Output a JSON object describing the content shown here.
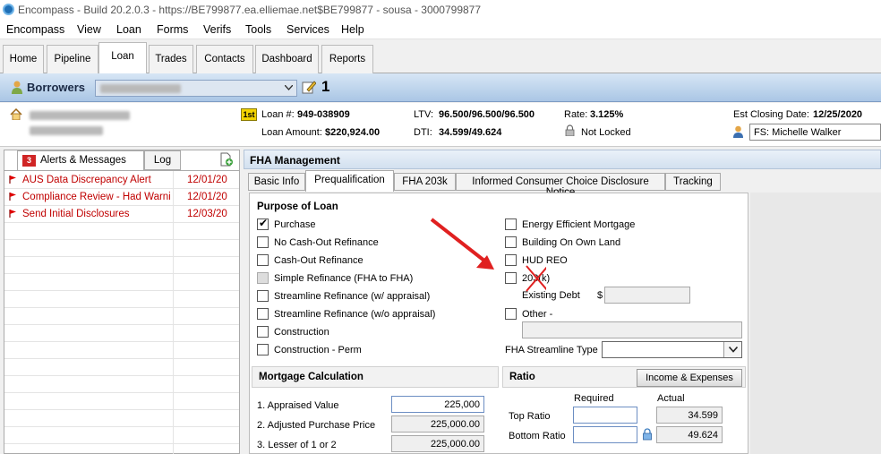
{
  "window": {
    "title": "Encompass - Build 20.2.0.3 - https://BE799877.ea.elliemae.net$BE799877 - sousa - 3000799877"
  },
  "menu": [
    "Encompass",
    "View",
    "Loan",
    "Forms",
    "Verifs",
    "Tools",
    "Services",
    "Help"
  ],
  "main_tabs": [
    "Home",
    "Pipeline",
    "Loan",
    "Trades",
    "Contacts",
    "Dashboard",
    "Reports"
  ],
  "active_main_tab": "Loan",
  "borrowers": {
    "label": "Borrowers",
    "number": "1"
  },
  "loan_info": {
    "loan_num_label": "Loan #:",
    "loan_num": "949-038909",
    "loan_amount_label": "Loan Amount:",
    "loan_amount": "$220,924.00",
    "ltv_label": "LTV:",
    "ltv": "96.500/96.500/96.500",
    "dti_label": "DTI:",
    "dti": "34.599/49.624",
    "rate_label": "Rate:",
    "rate": "3.125%",
    "lock_status": "Not Locked",
    "closing_label": "Est Closing Date:",
    "closing_date": "12/25/2020",
    "fs_value": "FS: Michelle Walker",
    "lien_badge": "1st"
  },
  "left_panel": {
    "tabs": {
      "alerts_count": "3",
      "alerts_label": "Alerts & Messages",
      "log_label": "Log"
    },
    "alerts": [
      {
        "text": "AUS Data Discrepancy Alert",
        "date": "12/01/20"
      },
      {
        "text": "Compliance Review - Had Warnings",
        "date": "12/01/20"
      },
      {
        "text": "Send Initial Disclosures",
        "date": "12/03/20"
      }
    ]
  },
  "fha": {
    "title": "FHA Management",
    "tabs": [
      "Basic Info",
      "Prequalification",
      "FHA 203k",
      "Informed Consumer Choice Disclosure Notice",
      "Tracking"
    ],
    "active_tab": "Prequalification",
    "purpose": {
      "title": "Purpose of Loan",
      "left_items": [
        {
          "label": "Purchase",
          "checked": true
        },
        {
          "label": "No Cash-Out Refinance",
          "checked": false
        },
        {
          "label": "Cash-Out Refinance",
          "checked": false
        },
        {
          "label": "Simple Refinance (FHA to FHA)",
          "checked": false
        },
        {
          "label": "Streamline Refinance (w/ appraisal)",
          "checked": false
        },
        {
          "label": "Streamline Refinance (w/o appraisal)",
          "checked": false
        },
        {
          "label": "Construction",
          "checked": false
        },
        {
          "label": "Construction - Perm",
          "checked": false
        }
      ],
      "right_items": [
        {
          "label": "Energy Efficient Mortgage",
          "checked": false
        },
        {
          "label": "Building On Own Land",
          "checked": false
        },
        {
          "label": "HUD REO",
          "checked": false
        },
        {
          "label": "203(k)",
          "checked": false
        },
        {
          "label": "Other -",
          "checked": false
        }
      ],
      "existing_debt_label": "Existing Debt",
      "dollar": "$",
      "streamline_label": "FHA Streamline Type"
    },
    "mortgage_calc": {
      "title": "Mortgage Calculation",
      "rows": [
        {
          "label": "1. Appraised Value",
          "value": "225,000"
        },
        {
          "label": "2. Adjusted Purchase Price",
          "value": "225,000.00"
        },
        {
          "label": "3. Lesser of 1 or 2",
          "value": "225,000.00"
        }
      ]
    },
    "ratio": {
      "title": "Ratio",
      "button": "Income & Expenses",
      "col_required": "Required",
      "col_actual": "Actual",
      "rows": [
        {
          "label": "Top Ratio",
          "required": "",
          "actual": "34.599"
        },
        {
          "label": "Bottom Ratio",
          "required": "",
          "actual": "49.624"
        }
      ]
    }
  },
  "colors": {
    "alert_red": "#c00000",
    "annotation_red": "#e02020",
    "header_blue": "#aac6e5"
  }
}
